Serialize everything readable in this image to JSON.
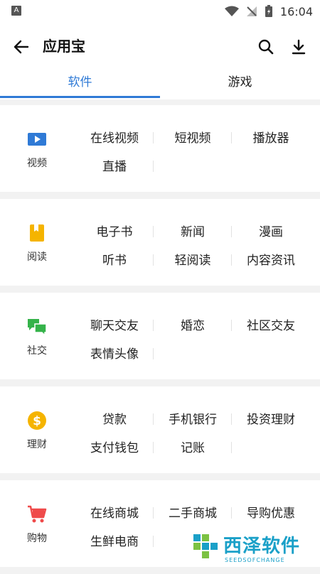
{
  "status_bar": {
    "app_badge": "A",
    "time": "16:04"
  },
  "header": {
    "title": "应用宝"
  },
  "tabs": [
    {
      "label": "软件",
      "active": true
    },
    {
      "label": "游戏",
      "active": false
    }
  ],
  "categories": [
    {
      "label": "视频",
      "icon": "video-icon",
      "color": "#2f7ad6",
      "rows": [
        [
          "在线视频",
          "短视频",
          "播放器"
        ],
        [
          "直播"
        ]
      ]
    },
    {
      "label": "阅读",
      "icon": "book-icon",
      "color": "#f5b400",
      "rows": [
        [
          "电子书",
          "新闻",
          "漫画"
        ],
        [
          "听书",
          "轻阅读",
          "内容资讯"
        ]
      ]
    },
    {
      "label": "社交",
      "icon": "chat-icon",
      "color": "#35b34a",
      "rows": [
        [
          "聊天交友",
          "婚恋",
          "社区交友"
        ],
        [
          "表情头像"
        ]
      ]
    },
    {
      "label": "理财",
      "icon": "dollar-icon",
      "color": "#f5b400",
      "rows": [
        [
          "贷款",
          "手机银行",
          "投资理财"
        ],
        [
          "支付钱包",
          "记账"
        ]
      ]
    },
    {
      "label": "购物",
      "icon": "cart-icon",
      "color": "#ef4a4a",
      "rows": [
        [
          "在线商城",
          "二手商城",
          "导购优惠"
        ],
        [
          "生鲜电商"
        ]
      ]
    }
  ],
  "watermark": {
    "text": "西泽软件",
    "sub": "SEEDSOFCHANGE"
  },
  "colors": {
    "accent": "#2f7ad6",
    "watermark": "#1aa0c8"
  }
}
